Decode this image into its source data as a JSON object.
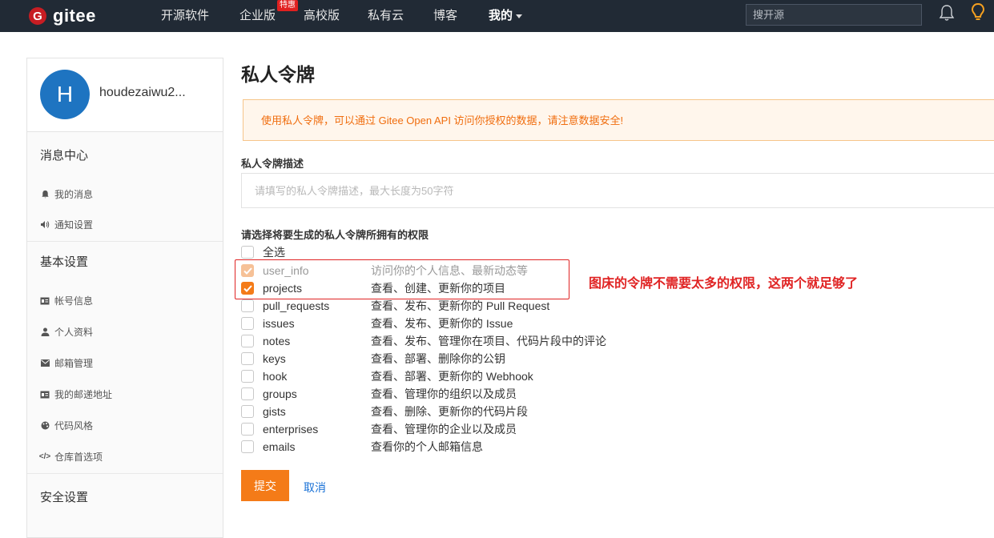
{
  "nav": {
    "brand": "gitee",
    "brand_mark": "G",
    "items": [
      "开源软件",
      "企业版",
      "高校版",
      "私有云",
      "博客",
      "我的"
    ],
    "hot_badge": "特惠",
    "search_placeholder": "搜开源",
    "accent": "#c71d23"
  },
  "sidebar": {
    "avatar_letter": "H",
    "username": "houdezaiwu2...",
    "groups": [
      {
        "title": "消息中心",
        "items": [
          {
            "icon": "bell-icon",
            "label": "我的消息"
          },
          {
            "icon": "speaker-icon",
            "label": "通知设置"
          }
        ]
      },
      {
        "title": "基本设置",
        "items": [
          {
            "icon": "id-card-icon",
            "label": "帐号信息"
          },
          {
            "icon": "user-icon",
            "label": "个人资料"
          },
          {
            "icon": "envelope-icon",
            "label": "邮箱管理"
          },
          {
            "icon": "address-card-icon",
            "label": "我的邮递地址"
          },
          {
            "icon": "palette-icon",
            "label": "代码风格"
          },
          {
            "icon": "code-icon",
            "label": "仓库首选项"
          }
        ]
      },
      {
        "title": "安全设置",
        "items": []
      }
    ]
  },
  "main": {
    "title": "私人令牌",
    "notice": "使用私人令牌，可以通过 Gitee Open API 访问你授权的数据，请注意数据安全!",
    "desc_label": "私人令牌描述",
    "desc_placeholder": "请填写的私人令牌描述，最大长度为50字符",
    "perm_label": "请选择将要生成的私人令牌所拥有的权限",
    "select_all": "全选",
    "permissions": [
      {
        "name": "user_info",
        "desc": "访问你的个人信息、最新动态等",
        "checked": true,
        "disabled": true
      },
      {
        "name": "projects",
        "desc": "查看、创建、更新你的项目",
        "checked": true,
        "disabled": false
      },
      {
        "name": "pull_requests",
        "desc": "查看、发布、更新你的 Pull Request",
        "checked": false,
        "disabled": false
      },
      {
        "name": "issues",
        "desc": "查看、发布、更新你的 Issue",
        "checked": false,
        "disabled": false
      },
      {
        "name": "notes",
        "desc": "查看、发布、管理你在项目、代码片段中的评论",
        "checked": false,
        "disabled": false
      },
      {
        "name": "keys",
        "desc": "查看、部署、删除你的公钥",
        "checked": false,
        "disabled": false
      },
      {
        "name": "hook",
        "desc": "查看、部署、更新你的 Webhook",
        "checked": false,
        "disabled": false
      },
      {
        "name": "groups",
        "desc": "查看、管理你的组织以及成员",
        "checked": false,
        "disabled": false
      },
      {
        "name": "gists",
        "desc": "查看、删除、更新你的代码片段",
        "checked": false,
        "disabled": false
      },
      {
        "name": "enterprises",
        "desc": "查看、管理你的企业以及成员",
        "checked": false,
        "disabled": false
      },
      {
        "name": "emails",
        "desc": "查看你的个人邮箱信息",
        "checked": false,
        "disabled": false
      }
    ],
    "annotation": "图床的令牌不需要太多的权限，这两个就足够了",
    "submit": "提交",
    "cancel": "取消",
    "accent": "#f47b18"
  }
}
